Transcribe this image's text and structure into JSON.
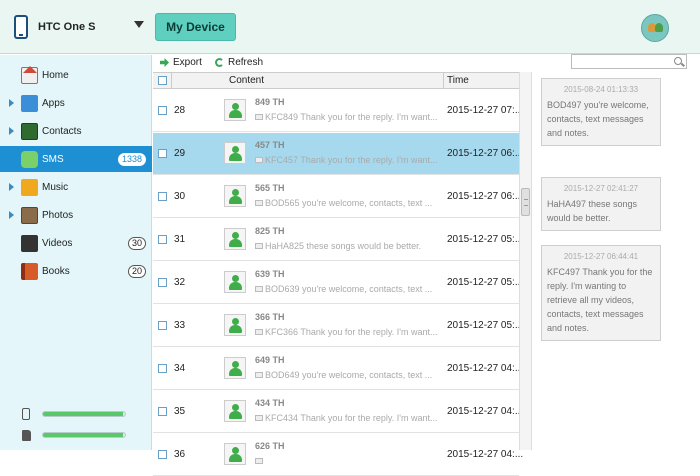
{
  "header": {
    "device_name": "HTC One S",
    "my_device_label": "My Device"
  },
  "sidebar": {
    "items": [
      {
        "label": "Home",
        "icon": "home-icon",
        "count": ""
      },
      {
        "label": "Apps",
        "icon": "apps-icon",
        "count": ""
      },
      {
        "label": "Contacts",
        "icon": "contacts-icon",
        "count": ""
      },
      {
        "label": "SMS",
        "icon": "sms-icon",
        "count": "1338"
      },
      {
        "label": "Music",
        "icon": "music-icon",
        "count": ""
      },
      {
        "label": "Photos",
        "icon": "photos-icon",
        "count": ""
      },
      {
        "label": "Videos",
        "icon": "videos-icon",
        "count": "30"
      },
      {
        "label": "Books",
        "icon": "books-icon",
        "count": "20"
      }
    ],
    "storage": [
      {
        "name": "phone",
        "used_fraction": 0.97
      },
      {
        "name": "sd-card",
        "used_fraction": 0.97
      }
    ]
  },
  "toolbar": {
    "export_label": "Export",
    "refresh_label": "Refresh",
    "search_placeholder": ""
  },
  "list": {
    "columns": {
      "content": "Content",
      "time": "Time"
    },
    "rows": [
      {
        "num": "28",
        "sender": "849 TH",
        "preview": "KFC849 Thank you for the reply. I'm want...",
        "time": "2015-12-27 07:...",
        "selected": false
      },
      {
        "num": "29",
        "sender": "457 TH",
        "preview": "KFC457 Thank you for the reply. I'm want...",
        "time": "2015-12-27 06:...",
        "selected": true
      },
      {
        "num": "30",
        "sender": "565 TH",
        "preview": "BOD565 you're welcome, contacts, text ...",
        "time": "2015-12-27 06:...",
        "selected": false
      },
      {
        "num": "31",
        "sender": "825 TH",
        "preview": "HaHA825 these songs would be better.",
        "time": "2015-12-27 05:...",
        "selected": false
      },
      {
        "num": "32",
        "sender": "639 TH",
        "preview": "BOD639 you're welcome, contacts, text ...",
        "time": "2015-12-27 05:...",
        "selected": false
      },
      {
        "num": "33",
        "sender": "366 TH",
        "preview": "KFC366 Thank you for the reply. I'm want...",
        "time": "2015-12-27 05:...",
        "selected": false
      },
      {
        "num": "34",
        "sender": "649 TH",
        "preview": "BOD649 you're welcome, contacts, text ...",
        "time": "2015-12-27 04:...",
        "selected": false
      },
      {
        "num": "35",
        "sender": "434 TH",
        "preview": "KFC434 Thank you for the reply. I'm want...",
        "time": "2015-12-27 04:...",
        "selected": false
      },
      {
        "num": "36",
        "sender": "626 TH",
        "preview": "",
        "time": "2015-12-27 04:...",
        "selected": false
      }
    ]
  },
  "conversation": [
    {
      "time": "2015-08-24 01:13:33",
      "text": "BOD497 you're welcome, contacts, text messages and notes."
    },
    {
      "time": "2015-12-27 02:41:27",
      "text": "HaHA497 these songs would be better."
    },
    {
      "time": "2015-12-27 06:44:41",
      "text": "KFC497 Thank you for the reply. I'm wanting to retrieve all my videos, contacts, text messages and notes."
    }
  ]
}
